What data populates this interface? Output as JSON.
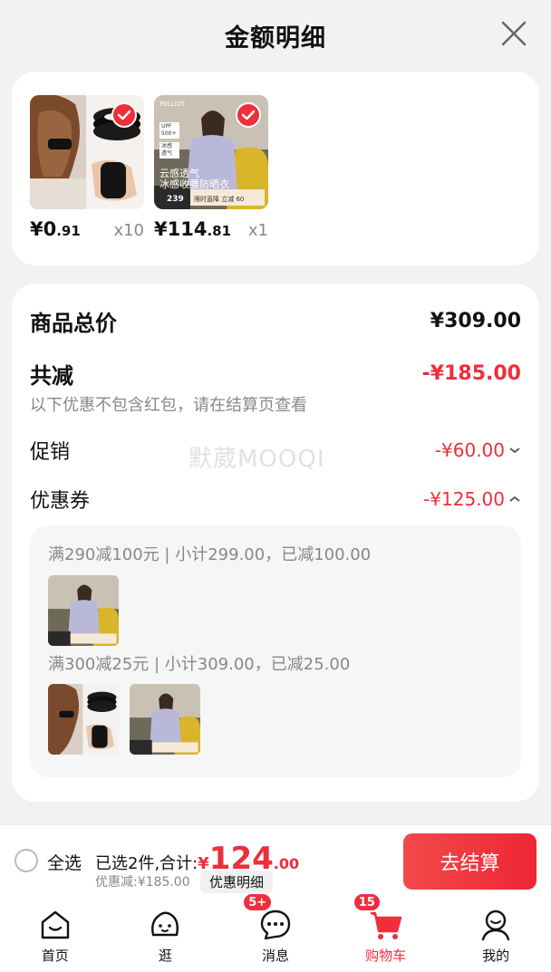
{
  "header": {
    "title": "金额明细"
  },
  "products": [
    {
      "price_int": "¥0",
      "price_dec": ".91",
      "qty": "x10",
      "checked": true
    },
    {
      "price_int": "¥114",
      "price_dec": ".81",
      "qty": "x1",
      "checked": true
    }
  ],
  "product_image_text": {
    "brand": "PELLIOT",
    "tag1": "UPF 500+",
    "tag2": "冰感 透气",
    "line1": "云感透气",
    "line2": "冰感收腰防晒衣",
    "price": "239",
    "promo": "限时直降 立减 60"
  },
  "summary": {
    "total_label": "商品总价",
    "total_value": "¥309.00",
    "reduce_label": "共减",
    "reduce_value": "-¥185.00",
    "note": "以下优惠不包含红包，请在结算页查看",
    "promo_label": "促销",
    "promo_value": "-¥60.00",
    "coupon_label": "优惠券",
    "coupon_value": "-¥125.00"
  },
  "coupons": [
    {
      "text": "满290减100元 | 小计299.00，已减100.00"
    },
    {
      "text": "满300减25元 | 小计309.00，已减25.00"
    }
  ],
  "watermark": "默葳MOOQI",
  "bottom": {
    "select_all": "全选",
    "selected_text": "已选2件,合计:",
    "total_yen": "¥",
    "total_int": "124",
    "total_dec": ".00",
    "discount": "优惠减:¥185.00",
    "detail": "优惠明细",
    "checkout": "去结算"
  },
  "tabs": [
    {
      "label": "首页",
      "icon": "home-icon"
    },
    {
      "label": "逛",
      "icon": "browse-icon"
    },
    {
      "label": "消息",
      "icon": "message-icon",
      "badge": "5+"
    },
    {
      "label": "购物车",
      "icon": "cart-icon",
      "badge": "15",
      "active": true
    },
    {
      "label": "我的",
      "icon": "profile-icon"
    }
  ],
  "colors": {
    "accent": "#ef2e3c"
  }
}
